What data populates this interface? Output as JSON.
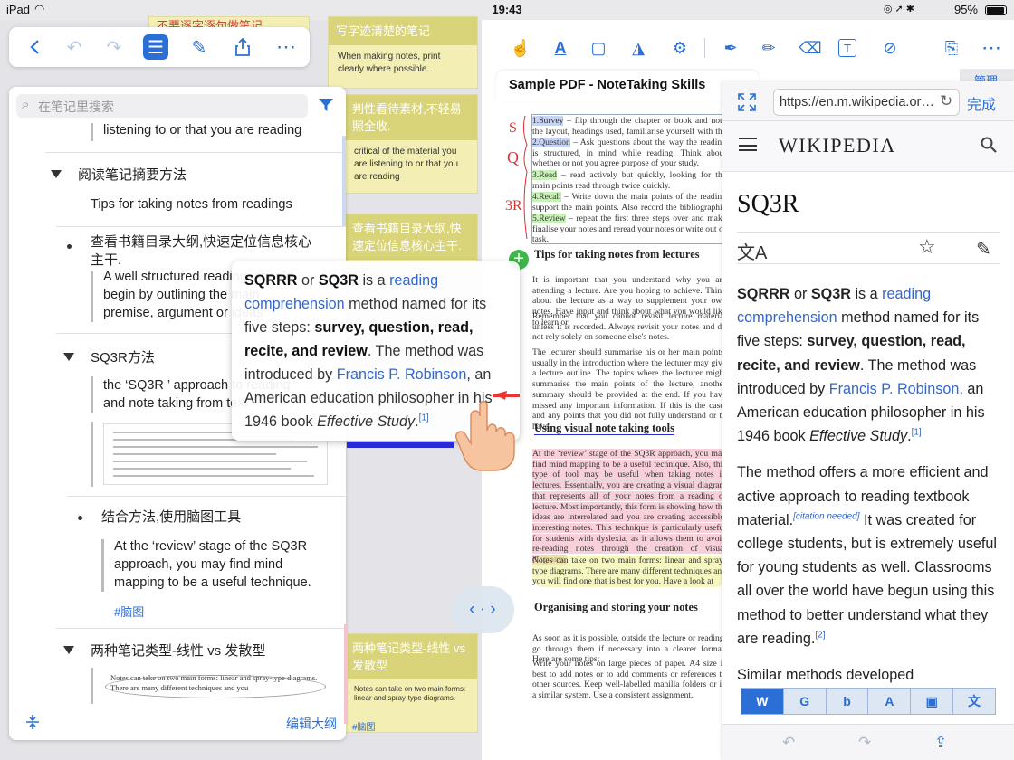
{
  "status_bar": {
    "device": "iPad",
    "time": "19:43",
    "battery": "95%"
  },
  "note_cards": [
    {
      "head": "不要逐字逐句做笔记",
      "body": ""
    },
    {
      "head": "写字迹清楚的笔记",
      "body": "When making notes, print clearly where possible."
    },
    {
      "head": "判性看待素材,不轻易照全收.",
      "body": "critical of the material you are listening to or that you are reading"
    },
    {
      "head": "查看书籍目录大纲,快速定位信息核心主干.",
      "body": "A well structured reading, should begin by outlining"
    },
    {
      "head": "两种笔记类型-线性 vs 发散型",
      "body": "Notes can take on two main forms: linear and spray-type diagrams."
    }
  ],
  "note_tag_bottom": "#脑图",
  "outline": {
    "search_placeholder": "在笔记里搜索",
    "items": [
      {
        "text": "listening to or that you are reading"
      },
      {
        "text": "阅读笔记摘要方法"
      },
      {
        "text": "Tips for taking notes from readings"
      },
      {
        "text": "查看书籍目录大纲,快速定位信息核心主干."
      },
      {
        "text": "A well structured reading, should begin by outlining the main premise, argument or ideas"
      },
      {
        "text": "SQ3R方法"
      },
      {
        "text": "the ‘SQ3R ’ approach to reading and note taking from text"
      },
      {
        "text": "结合方法,使用脑图工具"
      },
      {
        "text": "At the ‘review’ stage of the SQ3R approach, you may find mind mapping to be a useful technique."
      },
      {
        "text": "#脑图"
      },
      {
        "text": "两种笔记类型-线性 vs 发散型"
      },
      {
        "text": "Notes can take on two main forms: linear and spray-type diagrams. There are many different techniques and you"
      }
    ],
    "edit_label": "编辑大纲"
  },
  "popup": {
    "p1_a": "SQRRR",
    "p1_b": " or ",
    "p1_c": "SQ3R",
    "p1_d": " is a ",
    "p1_link1": "reading comprehension",
    "p1_e": " method named for its five steps: ",
    "p1_bold": "survey, question, read, recite, and review",
    "p1_f": ". The method was introduced by ",
    "p1_link2": "Francis P. Robinson",
    "p1_g": ", an American education philosopher in his 1946 book ",
    "p1_italic": "Effective Study",
    "p1_h": ".",
    "p1_sup": "[1]"
  },
  "pdf": {
    "tab_title": "Sample PDF - NoteTaking Skills",
    "manage_label": "管理",
    "sq3r_lines": [
      {
        "label": "1.Survey",
        "text": " – flip through the chapter or book and note the layout, headings used, familiarise yourself with the reading."
      },
      {
        "label": "2.Question",
        "text": " – Ask questions about the way the reading is structured, in mind while reading. Think about whether or not you agree purpose of your study."
      },
      {
        "label": "3.Read",
        "text": " – read actively but quickly, looking for the main points read through twice quickly."
      },
      {
        "label": "4.Recall",
        "text": " – Write down the main points of the reading support the main points. Also record the bibliographic details."
      },
      {
        "label": "5.Review",
        "text": " – repeat the first three steps over and make finalise your notes and reread your notes or write out or task."
      }
    ],
    "h1": "Tips for taking notes from lectures",
    "p1": "It is important that you understand why you are attending a lecture. Are you hoping to achieve. Think about the lecture as a way to supplement your own notes. Have input and think about what you would like to learn or",
    "p2": "Remember that you cannot revisit lecture material unless it is recorded. Always revisit your notes and do not rely solely on someone else's notes.",
    "p3": "The lecturer should summarise his or her main points, usually in the introduction where the lecturer may give a lecture outline. The topics where the lecturer might summarise the main points of the lecture, another summary should be provided at the end. If you have missed any important information. If this is the case, and any points that you did not fully understand or to have",
    "h2": "Using visual note taking tools",
    "p4": "At the ‘review’ stage of the SQ3R approach, you may find mind mapping to be a useful technique. Also, this type of tool may be useful when taking notes in lectures. Essentially, you are creating a visual diagram that represents all of your notes from a reading or lecture. Most importantly, this form is showing how the ideas are interrelated and you are creating accessible, interesting notes. This technique is particularly useful for students with dyslexia, as it allows them to avoid re-reading notes through the creation of visual diagrams.",
    "p5": "Notes can take on two main forms: linear and spray-type diagrams. There are many different techniques and you will find one that is best for you. Have a look at",
    "h3": "Organising and storing your notes",
    "p6": "As soon as it is possible, outside the lecture or reading, go through them if necessary into a clearer format. Here are some tips:",
    "p7": "Write your notes on large pieces of paper. A4 size is best to add notes or to add comments or references to other sources. Keep well-labelled manilla folders or in a similar system. Use a consistent assignment."
  },
  "wiki": {
    "url": "https://en.m.wikipedia.org/wiki/SQ3R",
    "done_label": "完成",
    "logo": "WIKIPEDIA",
    "title": "SQ3R",
    "p1_a": "SQRRR",
    "p1_b": " or ",
    "p1_c": "SQ3R",
    "p1_d": " is a ",
    "p1_link1": "reading comprehension",
    "p1_e": " method named for its five steps: ",
    "p1_bold": "survey, question, read, recite, and review",
    "p1_f": ". The method was introduced by ",
    "p1_link2": "Francis P. Robinson",
    "p1_g": ", an American education philosopher in his 1946 book ",
    "p1_italic": "Effective Study",
    "p1_h": ".",
    "p1_sup": "[1]",
    "p2_a": "The method offers a more efficient and active approach to reading textbook material.",
    "p2_cite": "[citation needed]",
    "p2_b": " It was created for college students, but is extremely useful for young students as well. Classrooms all over the world have begun using this method to better understand what they are reading.",
    "p2_sup": "[2]",
    "p3": "Similar methods developed"
  },
  "search_engines": [
    {
      "name": "wikipedia",
      "glyph": "W"
    },
    {
      "name": "google",
      "glyph": "G"
    },
    {
      "name": "bing",
      "glyph": "b"
    },
    {
      "name": "translate",
      "glyph": "A"
    },
    {
      "name": "images",
      "glyph": "▣"
    },
    {
      "name": "dictionary",
      "glyph": "文"
    }
  ]
}
